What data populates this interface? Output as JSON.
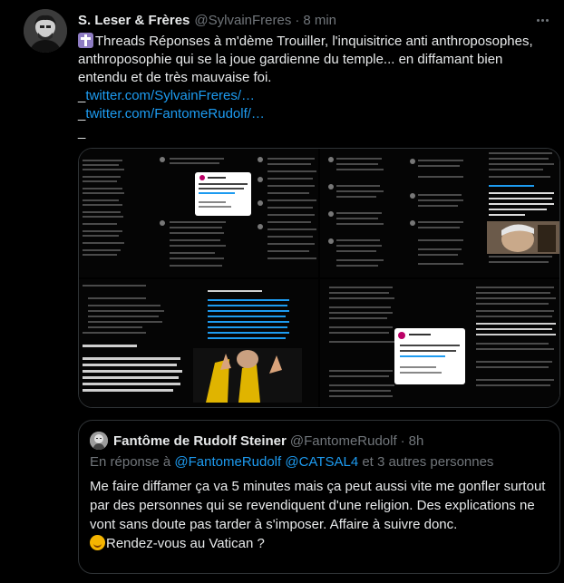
{
  "tweet": {
    "author_name": "S. Leser & Frères",
    "handle": "@SylvainFreres",
    "separator": "·",
    "time": "8 min",
    "text_line_1": "Threads Réponses à m'dème Trouiller, l'inquisitrice anti anthroposophes, anthroposophie qui se la joue gardienne du temple... en diffamant bien entendu et de très mauvaise foi.",
    "link_1_prefix": "_",
    "link_1": "twitter.com/SylvainFreres/…",
    "link_2_prefix": "_",
    "link_2": "twitter.com/FantomeRudolf/…",
    "link_3_prefix": "_",
    "icon": "cross-icon"
  },
  "media": {
    "images": [
      {
        "name": "thread-screenshot-1",
        "popup_text": "On va plutôt le soutenir et tout faire pour que tu disparaisses. @GregoirePerra"
      },
      {
        "name": "thread-screenshot-2",
        "caption": "Je vous laisse les cocí, mes amitiés au père Nicolas et si vous croisez le père BMQ passez lui un grand bonjour"
      },
      {
        "name": "thread-screenshot-3",
        "header": "Fantôme de Rudolf Steiner",
        "body": "Je viens de survoler l'ensemble de sa timeline Twitter. L'église ne peut ni ne doit cautionner toutes ces personnes si elle \"tweet\", \"retweet\", \"like\" et encourage. C'est trop trop grave en fait. Il y a des cas très, très lourds. La honte absolue, le tocsil. La laideur totale."
      },
      {
        "name": "thread-screenshot-4",
        "popup_text": "On va plutôt le soutenir et tout faire pour que tu disparaisses. @GregoirePerra"
      }
    ]
  },
  "quote": {
    "author_name": "Fantôme de Rudolf Steiner",
    "handle": "@FantomeRudolf",
    "separator": "·",
    "time": "8h",
    "reply_prefix": "En réponse à ",
    "reply_mentions": "@FantomeRudolf @CATSAL4",
    "reply_suffix": " et 3 autres personnes",
    "text": "Me faire diffamer ça va 5 minutes mais ça peut aussi vite me gonfler surtout par des personnes qui se revendiquent d'une religion. Des explications ne vont sans doute pas tarder à s'imposer. Affaire à suivre donc.",
    "closing": "Rendez-vous au Vatican ?",
    "emoji": "smiling-face-icon"
  },
  "colors": {
    "background": "#000000",
    "text": "#e7e9ea",
    "secondary": "#71767b",
    "link": "#1d9bf0",
    "border": "#2f3336"
  }
}
